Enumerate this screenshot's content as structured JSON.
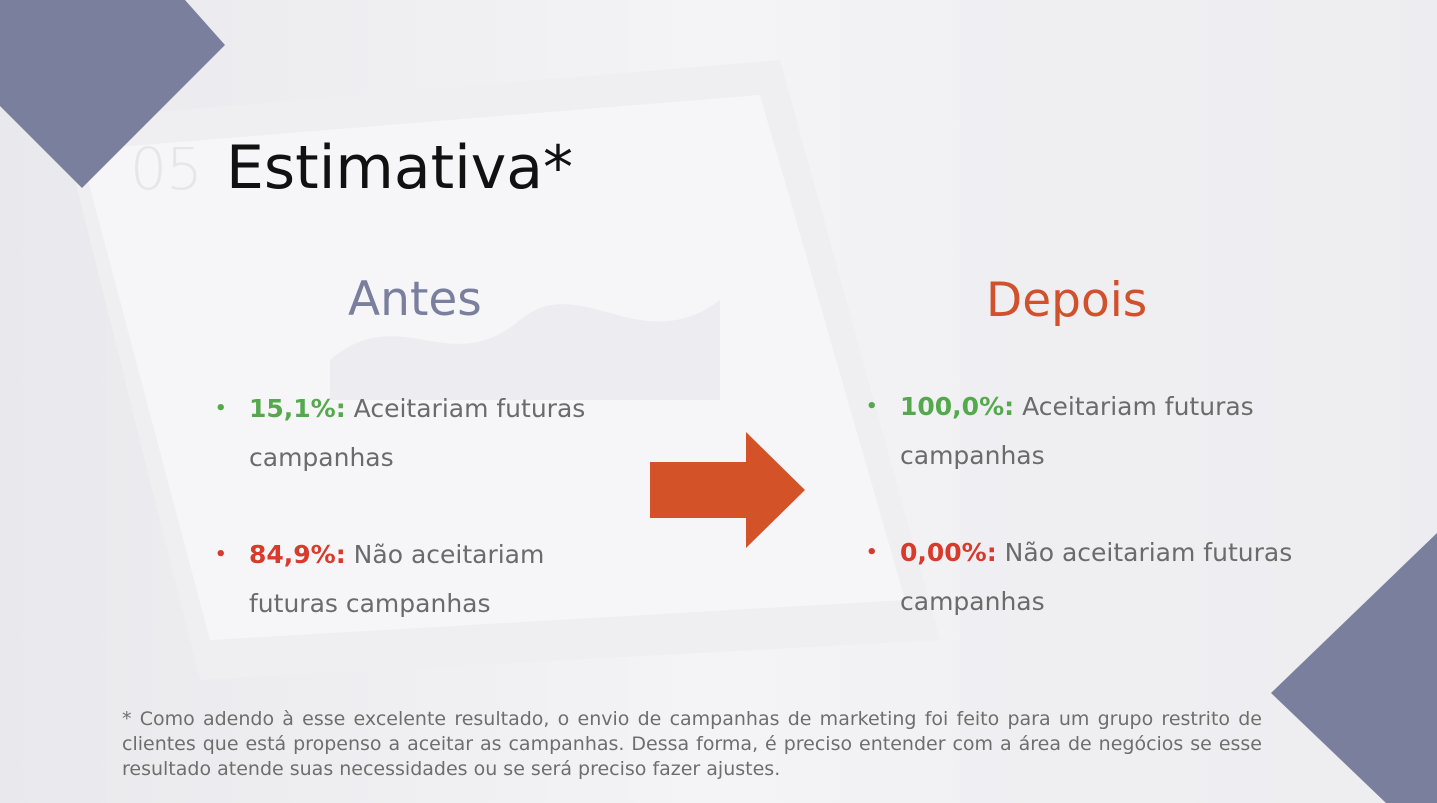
{
  "slide": {
    "number": "05",
    "title": "Estimativa*"
  },
  "colors": {
    "accent_navy": "#7a7f9e",
    "accent_orange": "#d0512b",
    "positive": "#55a94d",
    "negative": "#d83a2b",
    "arrow": "#d45227"
  },
  "before": {
    "heading": "Antes",
    "items": [
      {
        "pct": "15,1%:",
        "text": " Aceitariam futuras campanhas",
        "tone": "positive"
      },
      {
        "pct": "84,9%:",
        "text": " Não aceitariam futuras campanhas",
        "tone": "negative"
      }
    ]
  },
  "after": {
    "heading": "Depois",
    "items": [
      {
        "pct": "100,0%:",
        "text": " Aceitariam futuras campanhas",
        "tone": "positive"
      },
      {
        "pct": "0,00%:",
        "text": " Não aceitariam futuras campanhas",
        "tone": "negative"
      }
    ]
  },
  "footnote": "* Como adendo à esse excelente resultado, o envio de campanhas de marketing foi feito para um grupo restrito de clientes que está propenso a aceitar as campanhas. Dessa forma, é preciso entender com a área de negócios se esse resultado atende suas necessidades ou se será preciso fazer ajustes.",
  "icons": {
    "arrow": "arrow-right-icon"
  }
}
